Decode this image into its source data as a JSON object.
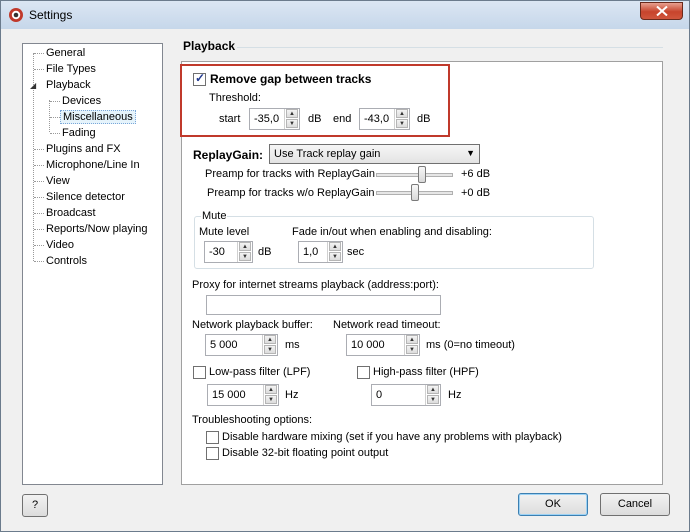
{
  "window": {
    "title": "Settings"
  },
  "tree": {
    "items": [
      {
        "label": "General"
      },
      {
        "label": "File Types"
      },
      {
        "label": "Playback"
      },
      {
        "label": "Devices"
      },
      {
        "label": "Miscellaneous"
      },
      {
        "label": "Fading"
      },
      {
        "label": "Plugins and FX"
      },
      {
        "label": "Microphone/Line In"
      },
      {
        "label": "View"
      },
      {
        "label": "Silence detector"
      },
      {
        "label": "Broadcast"
      },
      {
        "label": "Reports/Now playing"
      },
      {
        "label": "Video"
      },
      {
        "label": "Controls"
      }
    ]
  },
  "section_title": "Playback",
  "gap": {
    "checkbox_label": "Remove gap between tracks",
    "threshold_label": "Threshold:",
    "start_label": "start",
    "start_value": "-35,0",
    "start_unit": "dB",
    "end_label": "end",
    "end_value": "-43,0",
    "end_unit": "dB"
  },
  "replaygain": {
    "label": "ReplayGain:",
    "selected": "Use Track replay gain",
    "preamp_with_label": "Preamp for tracks with ReplayGain",
    "preamp_with_value": "+6 dB",
    "preamp_without_label": "Preamp for tracks w/o ReplayGain",
    "preamp_without_value": "+0 dB"
  },
  "mute": {
    "group_label": "Mute",
    "level_label": "Mute level",
    "level_value": "-30",
    "level_unit": "dB",
    "fade_label": "Fade in/out when enabling and disabling:",
    "fade_value": "1,0",
    "fade_unit": "sec"
  },
  "proxy": {
    "label": "Proxy for internet streams playback (address:port):",
    "value": ""
  },
  "network": {
    "buffer_label": "Network playback buffer:",
    "buffer_value": "5 000",
    "buffer_unit": "ms",
    "timeout_label": "Network read timeout:",
    "timeout_value": "10 000",
    "timeout_unit": "ms (0=no timeout)"
  },
  "filters": {
    "lpf_label": "Low-pass filter (LPF)",
    "lpf_value": "15 000",
    "lpf_unit": "Hz",
    "hpf_label": "High-pass filter (HPF)",
    "hpf_value": "0",
    "hpf_unit": "Hz"
  },
  "troubleshooting": {
    "label": "Troubleshooting options:",
    "hw_mixing": "Disable hardware mixing (set if you have any problems with playback)",
    "float_output": "Disable 32-bit floating point output"
  },
  "buttons": {
    "help": "?",
    "ok": "OK",
    "cancel": "Cancel"
  }
}
